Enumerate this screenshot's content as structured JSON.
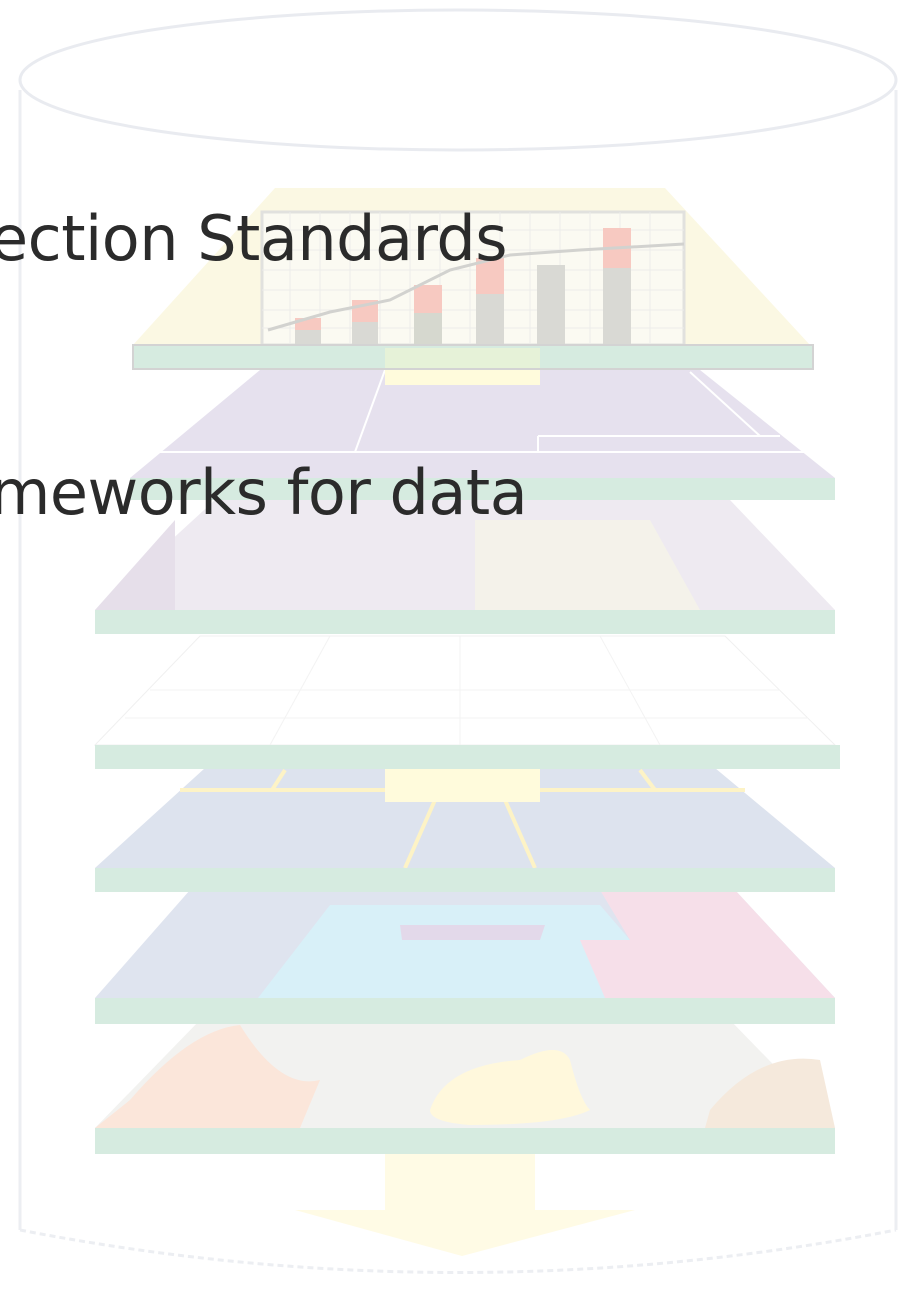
{
  "text": {
    "line1": "ection Standards",
    "line2": "meworks for data"
  },
  "colors": {
    "text": "#2b2b2b",
    "cylinder_outline": "#ebedf2",
    "layer_edge": "#d6ebe0",
    "connector": "#fffbdc",
    "chart_panel": "#fbf8e3",
    "purple_layer": "#e6e1ee",
    "blue_layer": "#dde3ee",
    "cyan_region": "#d8f0f8",
    "pink_region": "#f6dfe9",
    "peach_region": "#fbe6da",
    "gray_layer": "#f1f1ef",
    "bar_dark": "#d9d9d4",
    "bar_red": "#f7c9c1"
  },
  "icons": [
    "database-cylinder-icon",
    "bar-chart-icon",
    "down-arrow-icon"
  ]
}
